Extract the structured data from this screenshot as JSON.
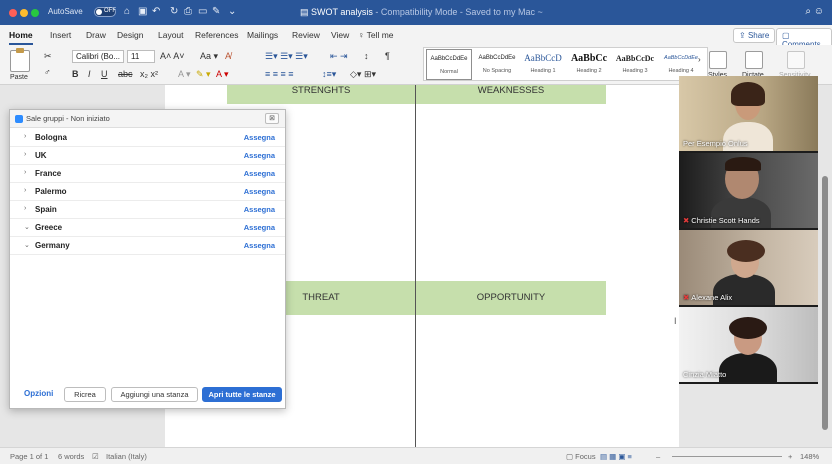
{
  "window": {
    "autosave_label": "AutoSave",
    "autosave_state": "OFF",
    "doc_title": "SWOT analysis",
    "doc_subtitle": "- Compatibility Mode - Saved to my Mac ~"
  },
  "ribbon_tabs": [
    "Home",
    "Insert",
    "Draw",
    "Design",
    "Layout",
    "References",
    "Mailings",
    "Review",
    "View",
    "Tell me"
  ],
  "ribbon_actions": {
    "share": "Share",
    "comments": "Comments"
  },
  "home_ribbon": {
    "paste": "Paste",
    "font_name": "Calibri (Bo...",
    "font_size": "11",
    "styles_label": "Styles",
    "dictate_label": "Dictate",
    "sensitivity_label": "Sensitivity"
  },
  "styles": [
    {
      "preview": "AaBbCcDdEe",
      "name": "Normal"
    },
    {
      "preview": "AaBbCcDdEe",
      "name": "No Spacing"
    },
    {
      "preview": "AaBbCcD",
      "name": "Heading 1"
    },
    {
      "preview": "AaBbCc",
      "name": "Heading 2"
    },
    {
      "preview": "AaBbCcDc",
      "name": "Heading 3"
    },
    {
      "preview": "AaBbCcDdEe",
      "name": "Heading 4"
    }
  ],
  "document": {
    "swot": {
      "strengths": "STRENGHTS",
      "weaknesses": "WEAKNESSES",
      "threat": "THREAT",
      "opportunity": "OPPORTUNITY"
    },
    "highlight_color": "#c6dfac"
  },
  "status_bar": {
    "page": "Page 1 of 1",
    "words": "6 words",
    "language": "Italian (Italy)",
    "focus": "Focus",
    "zoom": "148%"
  },
  "breakout": {
    "title": "Sale gruppi - Non iniziato",
    "close": "⊠",
    "rooms": [
      {
        "name": "Bologna",
        "action": "Assegna",
        "expanded": false
      },
      {
        "name": "UK",
        "action": "Assegna",
        "expanded": false
      },
      {
        "name": "France",
        "action": "Assegna",
        "expanded": false
      },
      {
        "name": "Palermo",
        "action": "Assegna",
        "expanded": false
      },
      {
        "name": "Spain",
        "action": "Assegna",
        "expanded": false
      },
      {
        "name": "Greece",
        "action": "Assegna",
        "expanded": true
      },
      {
        "name": "Germany",
        "action": "Assegna",
        "expanded": true
      }
    ],
    "options": "Opzioni",
    "recreate": "Ricrea",
    "add_room": "Aggiungi una stanza",
    "open_all": "Apri tutte le stanze",
    "accent_color": "#2d6fd4"
  },
  "participants": [
    {
      "name": "Per Esempio Onlus",
      "muted": false,
      "active": false
    },
    {
      "name": "Christie Scott Hands",
      "muted": true,
      "active": false
    },
    {
      "name": "Alexane Alix",
      "muted": true,
      "active": false
    },
    {
      "name": "Cinzia Miatto",
      "muted": false,
      "active": true
    }
  ]
}
